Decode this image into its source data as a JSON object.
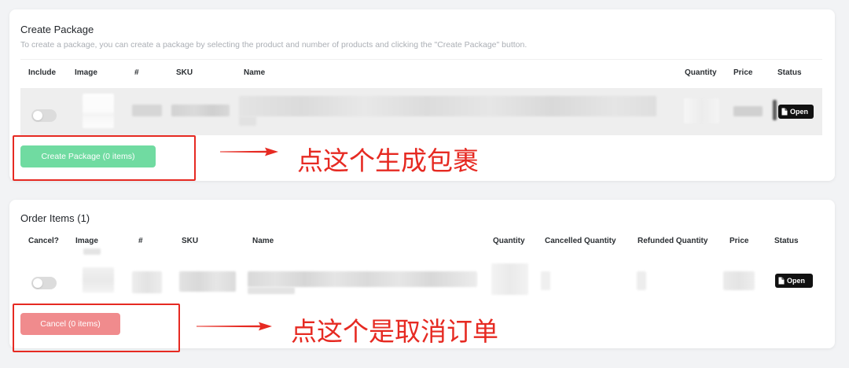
{
  "create_package": {
    "title": "Create Package",
    "description": "To create a package, you can create a package by selecting the product and number of products and clicking the \"Create Package\" button.",
    "columns": [
      "Include",
      "Image",
      "#",
      "SKU",
      "Name",
      "Quantity",
      "Price",
      "Status"
    ],
    "rows": [
      {
        "include": false,
        "status": "Open",
        "status_icon": "document-icon"
      }
    ],
    "button_label": "Create Package (0 items)",
    "button_color": "#70dba1"
  },
  "order_items": {
    "title": "Order Items (1)",
    "columns": [
      "Cancel?",
      "Image",
      "#",
      "SKU",
      "Name",
      "Quantity",
      "Cancelled Quantity",
      "Refunded Quantity",
      "Price",
      "Status"
    ],
    "rows": [
      {
        "cancel": false,
        "status": "Open",
        "status_icon": "document-icon"
      }
    ],
    "button_label": "Cancel (0 items)",
    "button_color": "#f08b8d"
  },
  "annotations": {
    "create_package_note": "点这个生成包裹",
    "cancel_note": "点这个是取消订单",
    "color": "#e62a22"
  },
  "colors": {
    "status_badge": "#111111"
  }
}
